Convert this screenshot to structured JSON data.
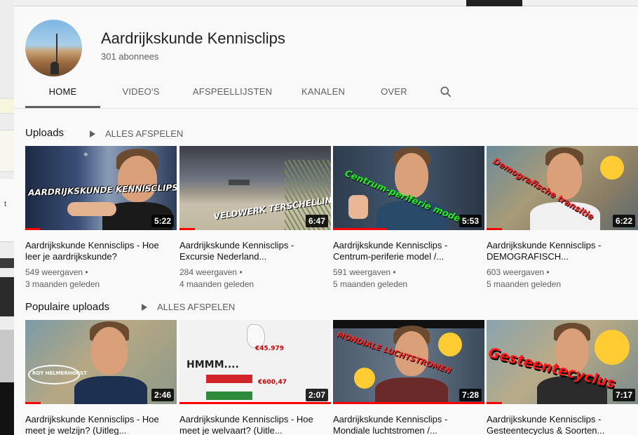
{
  "channel": {
    "name": "Aardrijkskunde Kennisclips",
    "subscribers": "301 abonnees"
  },
  "tabs": [
    {
      "label": "HOME",
      "active": true
    },
    {
      "label": "VIDEO'S",
      "active": false
    },
    {
      "label": "AFSPEELLIJSTEN",
      "active": false
    },
    {
      "label": "KANALEN",
      "active": false
    },
    {
      "label": "OVER",
      "active": false
    }
  ],
  "search_icon": "search-icon",
  "sections": [
    {
      "title": "Uploads",
      "play_all": "ALLES AFSPELEN",
      "videos": [
        {
          "title": "Aardrijkskunde Kennisclips - Hoe leer je aardrijkskunde?",
          "duration": "5:22",
          "views": "549 weergaven •",
          "age": "3 maanden geleden",
          "overlay": "AARDRIJKSKUNDE KENNISCLIPS",
          "progress": 0.1
        },
        {
          "title": "Aardrijkskunde Kennisclips - Excursie Nederland...",
          "duration": "6:47",
          "views": "284 weergaven •",
          "age": "4 maanden geleden",
          "overlay": "VELDWERK TERSCHELLIN",
          "progress": 0.1
        },
        {
          "title": "Aardrijkskunde Kennisclips - Centrum-periferie model /...",
          "duration": "5:53",
          "views": "591 weergaven •",
          "age": "5 maanden geleden",
          "overlay": "Centrum-periferie model",
          "progress": 0.35
        },
        {
          "title": "Aardrijkskunde Kennisclips - DEMOGRAFISCH...",
          "duration": "6:22",
          "views": "603 weergaven •",
          "age": "5 maanden geleden",
          "overlay": "Demografische transitie",
          "progress": 0.1
        }
      ]
    },
    {
      "title": "Populaire uploads",
      "play_all": "ALLES AFSPELEN",
      "videos": [
        {
          "title": "Aardrijkskunde Kennisclips - Hoe meet je welzijn? (Uitleg...",
          "duration": "2:46",
          "overlay": "ROY HELMERHORST",
          "progress": 0.1
        },
        {
          "title": "Aardrijkskunde Kennisclips - Hoe meet je welvaart? (Uitle...",
          "duration": "2:07",
          "overlay": "HMMM....",
          "overlay2": "€45.979",
          "overlay3": "€600,47",
          "progress": 1.0
        },
        {
          "title": "Aardrijkskunde Kennisclips - Mondiale luchtstromen /...",
          "duration": "7:28",
          "overlay": "MONDIALE LUCHTSTROMEN",
          "progress": 1.0
        },
        {
          "title": "Aardrijkskunde Kennisclips - Gesteentecyclus & Soorten...",
          "duration": "7:17",
          "overlay": "Gesteentecyclus",
          "progress": 0.1
        }
      ]
    }
  ],
  "background_window": {
    "label": "t"
  }
}
